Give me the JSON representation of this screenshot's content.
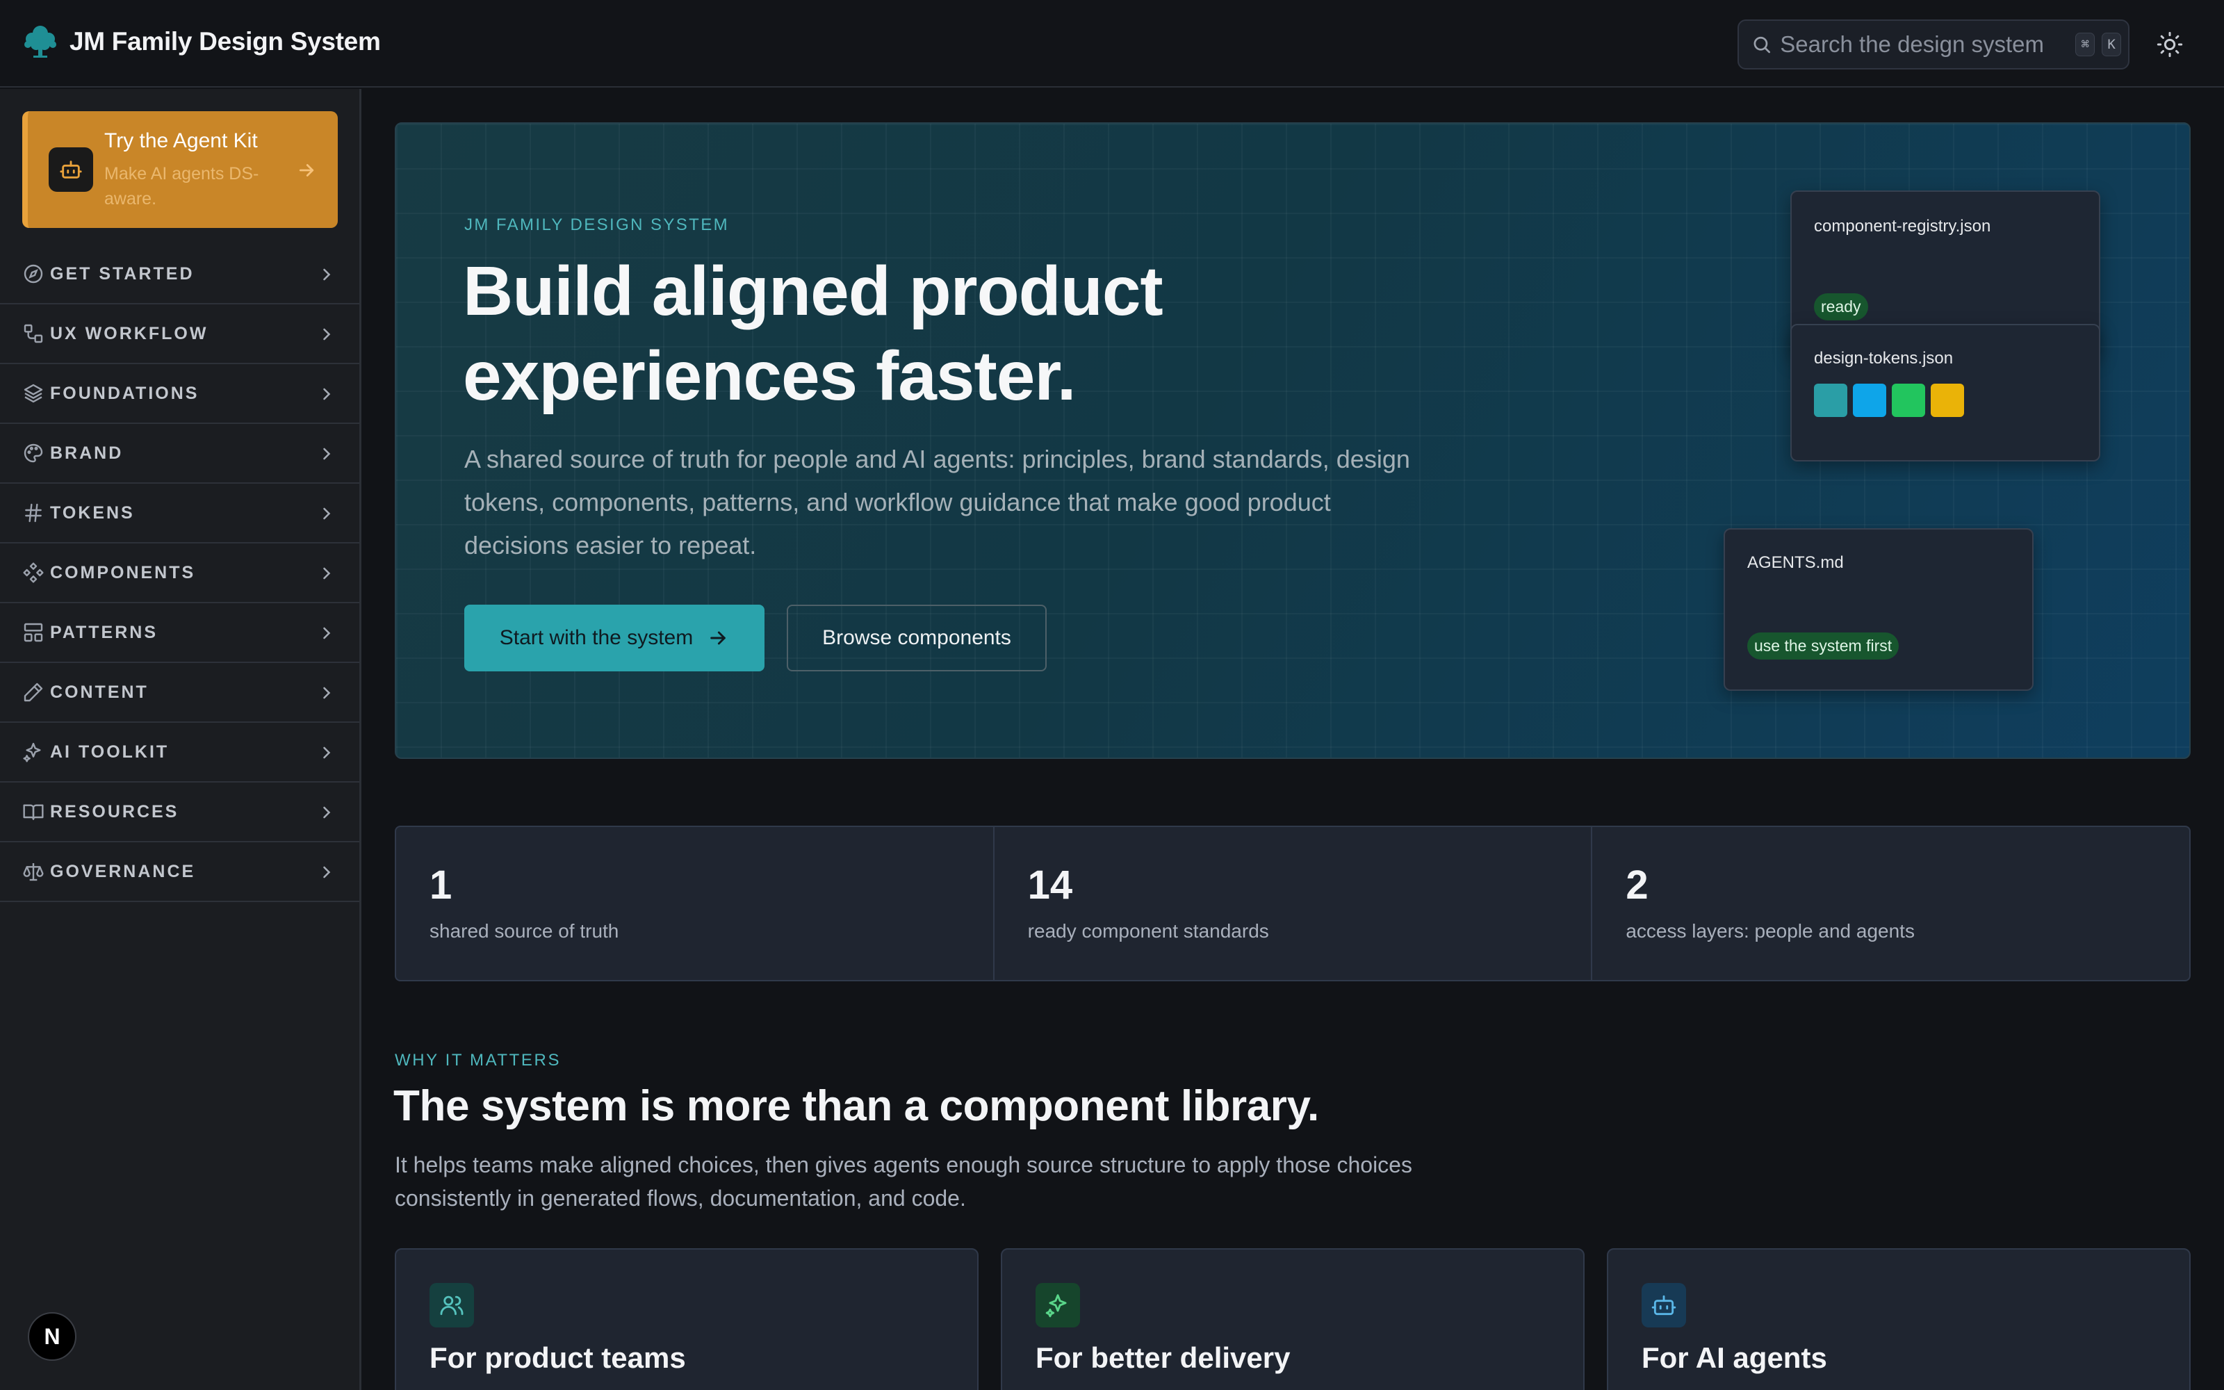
{
  "app": {
    "title": "JM Family Design System",
    "logo_icon": "tree-icon"
  },
  "search": {
    "placeholder": "Search the design system",
    "shortcut_keys": [
      "⌘",
      "K"
    ]
  },
  "theme_toggle_icon": "sun-icon",
  "promo": {
    "title": "Try the Agent Kit",
    "subtitle": "Make AI agents DS-aware.",
    "icon": "robot-icon",
    "accent_color": "#c98628"
  },
  "sidebar": {
    "items": [
      {
        "label": "GET STARTED",
        "icon": "compass-icon"
      },
      {
        "label": "UX WORKFLOW",
        "icon": "workflow-icon"
      },
      {
        "label": "FOUNDATIONS",
        "icon": "layers-icon"
      },
      {
        "label": "BRAND",
        "icon": "palette-icon"
      },
      {
        "label": "TOKENS",
        "icon": "hash-icon"
      },
      {
        "label": "COMPONENTS",
        "icon": "component-icon"
      },
      {
        "label": "PATTERNS",
        "icon": "layout-icon"
      },
      {
        "label": "CONTENT",
        "icon": "pen-icon"
      },
      {
        "label": "AI TOOLKIT",
        "icon": "sparkles-icon"
      },
      {
        "label": "RESOURCES",
        "icon": "book-icon"
      },
      {
        "label": "GOVERNANCE",
        "icon": "scale-icon"
      }
    ]
  },
  "dev_badge": {
    "label": "N"
  },
  "hero": {
    "eyebrow": "JM FAMILY DESIGN SYSTEM",
    "title": "Build aligned product experiences faster.",
    "description": "A shared source of truth for people and AI agents: principles, brand standards, design tokens, components, patterns, and workflow guidance that make good product decisions easier to repeat.",
    "primary_button": "Start with the system",
    "secondary_button": "Browse components",
    "cards": [
      {
        "name": "component-registry.json",
        "badge": "ready"
      },
      {
        "name": "design-tokens.json",
        "swatches": [
          "#2a9ea6",
          "#0ea5e9",
          "#22c55e",
          "#eab308"
        ]
      },
      {
        "name": "AGENTS.md",
        "badge": "use the system first"
      }
    ]
  },
  "stats": [
    {
      "value": "1",
      "label": "shared source of truth"
    },
    {
      "value": "14",
      "label": "ready component standards"
    },
    {
      "value": "2",
      "label": "access layers: people and agents"
    }
  ],
  "why": {
    "eyebrow": "WHY IT MATTERS",
    "title": "The system is more than a component library.",
    "description": "It helps teams make aligned choices, then gives agents enough source structure to apply those choices consistently in generated flows, documentation, and code.",
    "cards": [
      {
        "title": "For product teams",
        "icon": "users-icon",
        "icon_bg": "#15403f",
        "icon_color": "#55c2bd"
      },
      {
        "title": "For better delivery",
        "icon": "sparkles-icon",
        "icon_bg": "#16452c",
        "icon_color": "#5ad68a"
      },
      {
        "title": "For AI agents",
        "icon": "robot-icon",
        "icon_bg": "#173a55",
        "icon_color": "#5ab7e8"
      }
    ]
  }
}
